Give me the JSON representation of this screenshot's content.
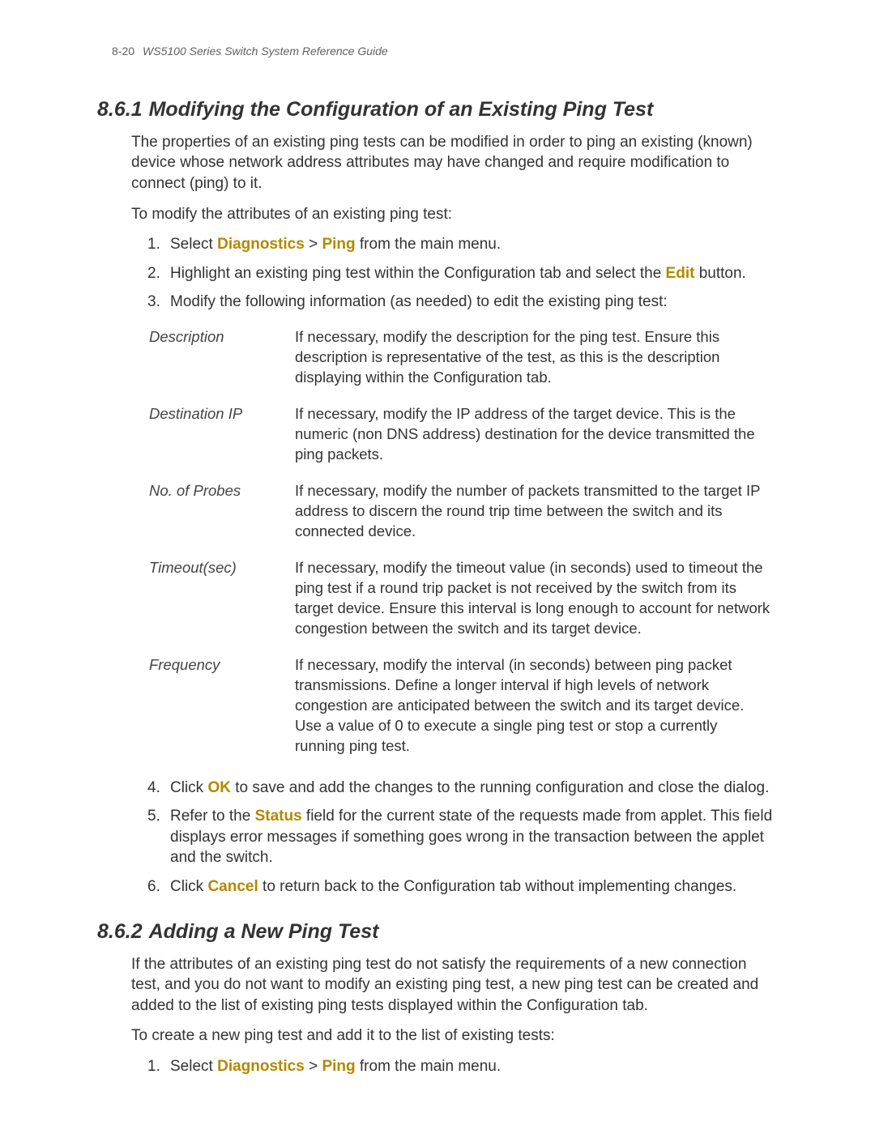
{
  "header": {
    "page_no": "8-20",
    "book_title": "WS5100 Series Switch System Reference Guide"
  },
  "section861": {
    "num": "8.6.1",
    "title": "Modifying the Configuration of an Existing Ping Test",
    "intro": "The properties of an existing ping tests can be modified in order to ping an existing (known) device whose network address attributes may have changed and require modification to connect (ping) to it.",
    "lead": "To modify the attributes of an existing ping test:",
    "step1": {
      "n": "1.",
      "pre": "Select ",
      "hl1": "Diagnostics",
      "mid": " > ",
      "hl2": "Ping",
      "post": " from the main menu."
    },
    "step2": {
      "n": "2.",
      "pre": "Highlight an existing ping test within the Configuration tab and select the ",
      "hl": "Edit",
      "post": " button."
    },
    "step3": {
      "n": "3.",
      "text": "Modify the following information (as needed) to edit the existing ping test:"
    },
    "defs": {
      "description": {
        "term": "Description",
        "text": "If necessary, modify the description for the ping test. Ensure this description is representative of the test, as this is the description displaying within the Configuration tab."
      },
      "destip": {
        "term": "Destination IP",
        "text": "If necessary, modify the IP address of the target device. This is the numeric (non DNS address) destination for the device transmitted the ping packets."
      },
      "probes": {
        "term": "No. of Probes",
        "text": "If necessary, modify the number of packets transmitted to the target IP address to discern the round trip time between the switch and its connected device."
      },
      "timeout": {
        "term": "Timeout(sec)",
        "text": "If necessary, modify the timeout value (in seconds) used to timeout the ping test if a round trip packet is not received by the switch from its target device. Ensure this interval is long enough to account for network congestion between the switch and its target device."
      },
      "freq": {
        "term": "Frequency",
        "text": "If necessary, modify the interval (in seconds) between ping packet transmissions. Define a longer interval if high levels of network congestion are anticipated between the switch and its target device. Use a value of 0 to execute a single ping test or stop a currently running ping test."
      }
    },
    "step4": {
      "n": "4.",
      "pre": "Click ",
      "hl": "OK",
      "post": " to save and add the changes to the running configuration and close the dialog."
    },
    "step5": {
      "n": "5.",
      "pre": "Refer to the ",
      "hl": "Status",
      "post": " field for the current state of the requests made from applet. This field displays error messages if something goes wrong in the transaction between the applet and the switch."
    },
    "step6": {
      "n": "6.",
      "pre": "Click ",
      "hl": "Cancel",
      "post": " to return back to the Configuration tab without implementing changes."
    }
  },
  "section862": {
    "num": "8.6.2",
    "title": "Adding a New Ping Test",
    "intro": "If the attributes of an existing ping test do not satisfy the requirements of a new connection test, and you do not want to modify an existing ping test, a new ping test can be created and added to the list of existing ping tests displayed within the Configuration tab.",
    "lead": "To create a new ping test and add it to the list of existing tests:",
    "step1": {
      "n": "1.",
      "pre": "Select ",
      "hl1": "Diagnostics",
      "mid": " > ",
      "hl2": "Ping",
      "post": " from the main menu."
    }
  }
}
